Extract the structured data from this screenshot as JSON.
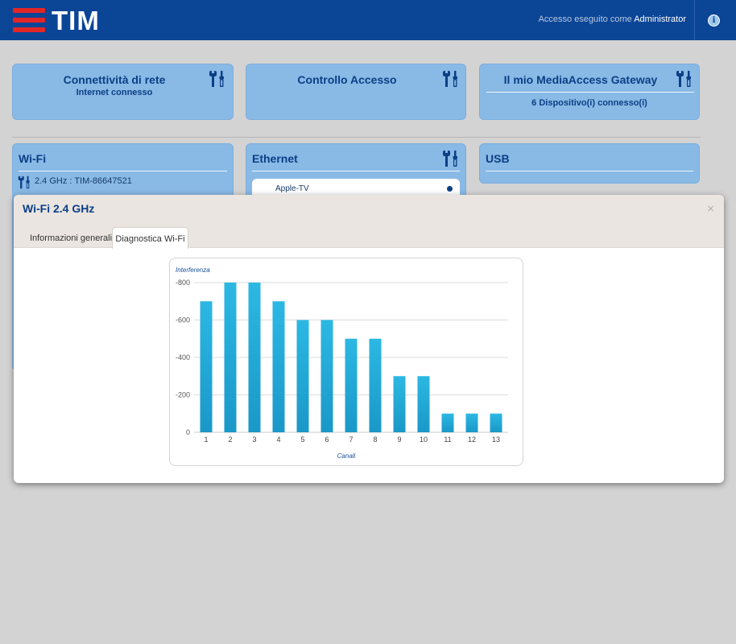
{
  "header": {
    "brand": "TIM",
    "login_prefix": "Accesso eseguito come",
    "login_user": "Administrator",
    "info_glyph": "i"
  },
  "cards": {
    "connectivity": {
      "title": "Connettività di rete",
      "subtitle": "Internet connesso"
    },
    "access_control": {
      "title": "Controllo Accesso"
    },
    "gateway": {
      "title": "Il mio MediaAccess Gateway",
      "subtitle": "6 Dispositivo(i) connesso(i)"
    },
    "wifi": {
      "title": "Wi-Fi",
      "network": "2.4 GHz : TIM-86647521"
    },
    "ethernet": {
      "title": "Ethernet",
      "device": "Apple-TV"
    },
    "usb": {
      "title": "USB"
    }
  },
  "icons": {
    "tools": "tools-icon",
    "info": "info-icon",
    "close": "close-icon"
  },
  "colors": {
    "header_bg": "#0b4596",
    "logo_red": "#e32626",
    "card_bg": "#89b9e5",
    "title_blue": "#0b3f86",
    "bar_top": "#2cb8e3",
    "bar_bottom": "#1a98c8"
  },
  "modal": {
    "title": "Wi-Fi 2.4 GHz",
    "close_glyph": "×",
    "tabs": [
      {
        "label": "Informazioni generali",
        "active": false
      },
      {
        "label": "Diagnostica Wi-Fi",
        "active": true
      }
    ]
  },
  "chart_data": {
    "type": "bar",
    "ylabel": "Interferenza",
    "xlabel": "Canali",
    "categories": [
      "1",
      "2",
      "3",
      "4",
      "5",
      "6",
      "7",
      "8",
      "9",
      "10",
      "11",
      "12",
      "13"
    ],
    "values": [
      -700,
      -800,
      -800,
      -700,
      -600,
      -600,
      -500,
      -500,
      -300,
      -300,
      -100,
      -100,
      -100
    ],
    "ylim": [
      0,
      -800
    ],
    "yticks": [
      {
        "value": -800,
        "label": "-800"
      },
      {
        "value": -600,
        "label": "-600"
      },
      {
        "value": -400,
        "label": "-400"
      },
      {
        "value": -200,
        "label": "-200"
      },
      {
        "value": 0,
        "label": "0"
      }
    ],
    "grid": true
  }
}
